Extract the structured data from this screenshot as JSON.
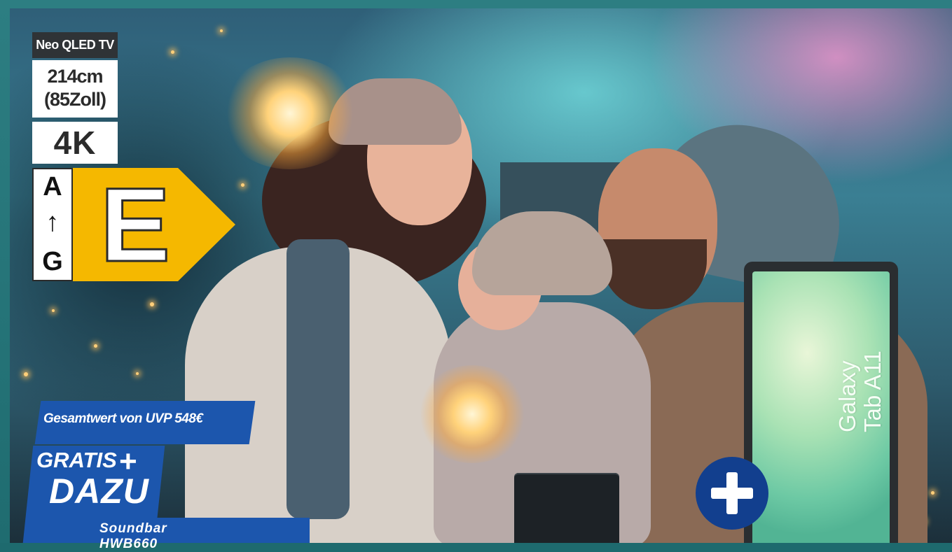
{
  "tv_specs": {
    "type_label": "Neo QLED TV",
    "size_cm": "214cm",
    "size_inch": "(85Zoll)",
    "resolution": "4K"
  },
  "energy_label": {
    "scale_top": "A",
    "scale_arrow": "↑",
    "scale_bottom": "G",
    "rating": "E",
    "rating_color": "#f5b800"
  },
  "promo": {
    "total_value": "Gesamtwert von UVP 548€",
    "gratis": "GRATIS",
    "plus": "+",
    "dazu": "DAZU",
    "item": "Soundbar HWB660",
    "brand_blue": "#1c56ad"
  },
  "tablet": {
    "line1": "Galaxy",
    "line2": "Tab A11"
  },
  "add_badge": {
    "icon": "plus-icon",
    "color": "#123f8e"
  }
}
